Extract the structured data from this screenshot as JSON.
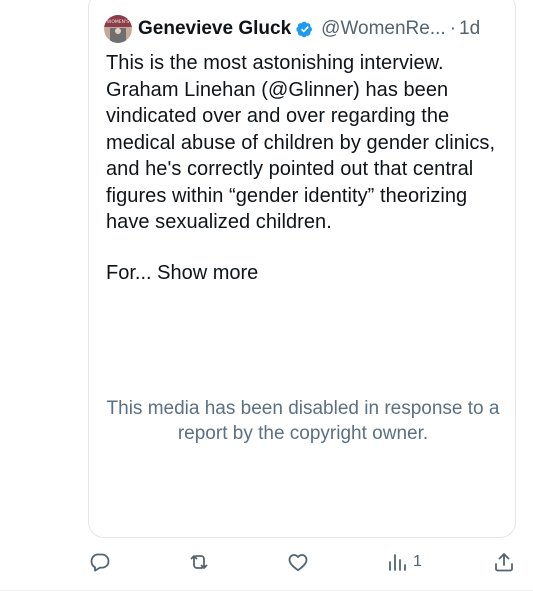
{
  "tweet": {
    "author_name": "Genevieve Gluck",
    "author_handle": "@WomenRe...",
    "separator": "·",
    "time": "1d",
    "avatar_text": "WOMEN'S",
    "text": "This is the most astonishing interview. Graham Linehan (@Glinner) has been vindicated over and over regarding the medical abuse of children by gender clinics, and he's correctly pointed out that central figures within “gender identity” theorizing have sexualized children.",
    "truncated_text": "For...",
    "show_more_label": "Show more",
    "media_notice": "This media has been disabled in response to a report by the copyright owner."
  },
  "actions": {
    "reply_count": "",
    "retweet_count": "",
    "like_count": "",
    "views_count": "1"
  },
  "colors": {
    "verified_badge": "#1d9bf0",
    "secondary_text": "#536471",
    "media_notice_text": "#5b7083",
    "border": "#e3e7ea"
  },
  "icons": [
    "verified-badge-icon",
    "reply-icon",
    "retweet-icon",
    "like-icon",
    "views-icon",
    "share-icon"
  ]
}
